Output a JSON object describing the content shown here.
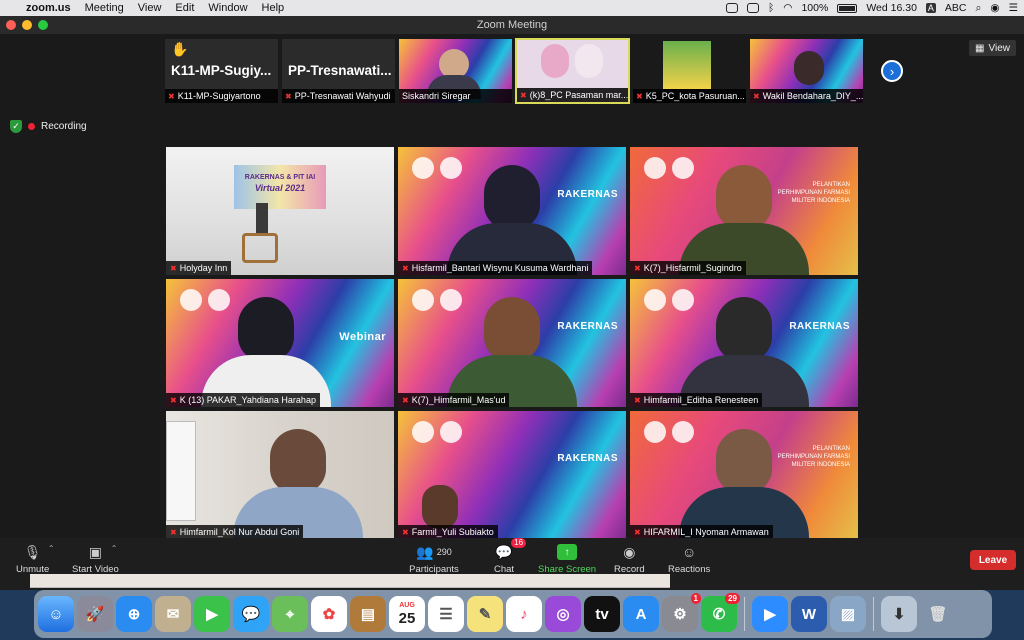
{
  "menubar": {
    "app": "zoom.us",
    "menus": [
      "Meeting",
      "View",
      "Edit",
      "Window",
      "Help"
    ],
    "battery": "100%",
    "clock": "Wed 16.30",
    "input_a": "A",
    "input_abc": "ABC"
  },
  "window": {
    "title": "Zoom Meeting"
  },
  "top_strip": [
    {
      "big": "K11-MP-Sugiy...",
      "label": "K11-MP-Sugiyartono",
      "hand": true,
      "muted": true
    },
    {
      "big": "PP-Tresnawati...",
      "label": "PP-Tresnawati Wahyudi",
      "hand": false,
      "muted": true
    },
    {
      "big": "",
      "label": "Siskandri Siregar",
      "hand": false,
      "muted": false
    },
    {
      "big": "",
      "label": "(k)8_PC Pasaman mar...",
      "hand": false,
      "muted": true
    },
    {
      "big": "",
      "label": "K5_PC_kota Pasuruan...",
      "hand": false,
      "muted": true
    },
    {
      "big": "",
      "label": "Wakil Bendahara_DIY_...",
      "hand": false,
      "muted": true
    }
  ],
  "view_button": "View",
  "recording": "Recording",
  "tiles": [
    {
      "label": "Holyday Inn",
      "stage_title": "RAKERNAS & PIT IAI",
      "stage_sub": "Virtual 2021"
    },
    {
      "label": "Hisfarmil_Bantari Wisynu Kusuma Wardhani",
      "banner": "RAKERNAS"
    },
    {
      "label": "K(7)_Hisfarmil_Sugindro",
      "banner": "PELANTIKAN PERHIMPUNAN FARMASI MILITER INDONESIA"
    },
    {
      "label": "K (13) PAKAR_Yahdiana Harahap",
      "banner": "Webinar"
    },
    {
      "label": "K(7)_Himfarmil_Mas'ud",
      "banner": "RAKERNAS"
    },
    {
      "label": "Himfarmil_Editha Renesteen",
      "banner": "RAKERNAS"
    },
    {
      "label": "Himfarmil_Kol Nur Abdul Goni",
      "banner": ""
    },
    {
      "label": "Farmil_Yuli Subiakto",
      "banner": "RAKERNAS"
    },
    {
      "label": "HIFARMIL_I Nyoman Armawan",
      "banner": "PELANTIKAN PERHIMPUNAN FARMASI MILITER INDONESIA"
    }
  ],
  "toolbar": {
    "unmute": "Unmute",
    "start_video": "Start Video",
    "participants": "Participants",
    "participants_count": "290",
    "chat": "Chat",
    "chat_badge": "16",
    "share": "Share Screen",
    "record": "Record",
    "reactions": "Reactions",
    "leave": "Leave"
  },
  "dock": {
    "calendar_month": "AUG",
    "calendar_day": "25",
    "appstore_badge": "1",
    "whatsapp_badge": "29"
  }
}
